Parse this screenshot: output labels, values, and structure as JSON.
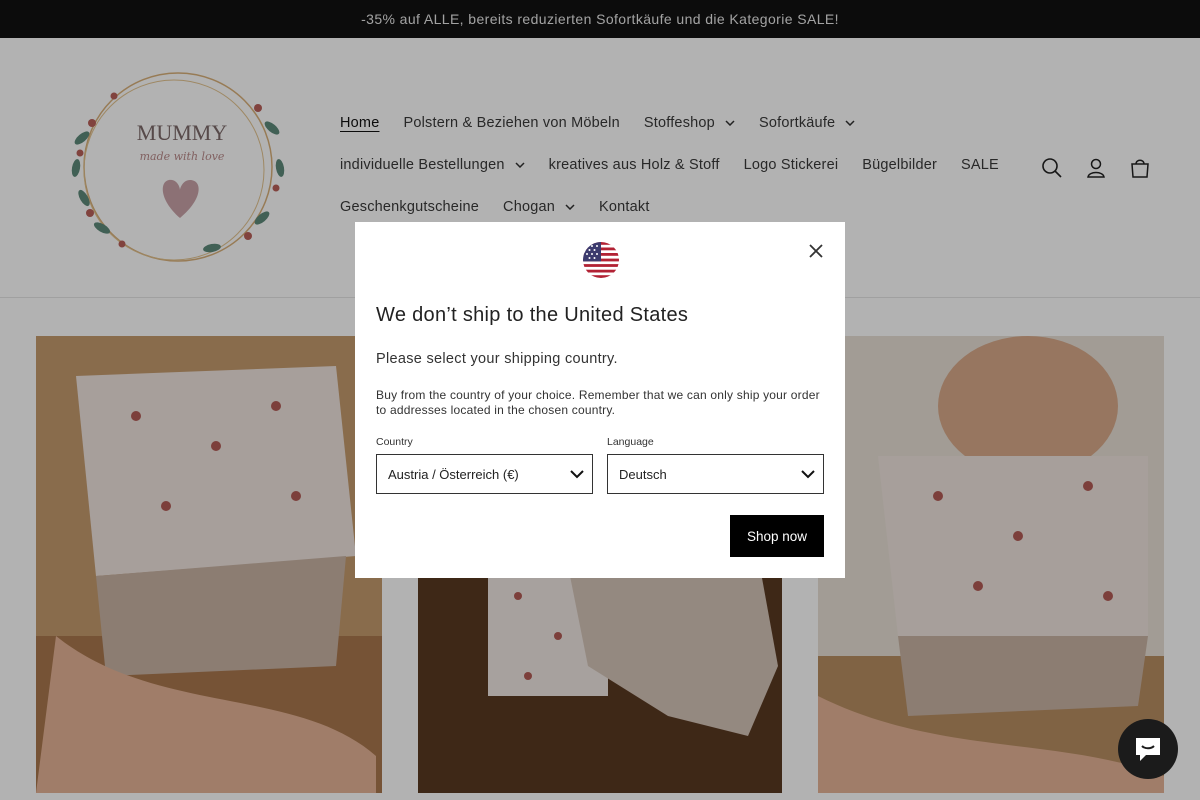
{
  "announcement": "-35% auf ALLE, bereits reduzierten Sofortkäufe und die Kategorie SALE!",
  "logo": {
    "text_top": "MUMMY",
    "text_script": "made with love",
    "icon": "floral-wreath-heart-logo"
  },
  "nav": {
    "rows": [
      [
        {
          "label": "Home",
          "active": true,
          "dropdown": false
        },
        {
          "label": "Polstern & Beziehen von Möbeln",
          "dropdown": false
        },
        {
          "label": "Stoffeshop",
          "dropdown": true
        },
        {
          "label": "Sofortkäufe",
          "dropdown": true
        }
      ],
      [
        {
          "label": "individuelle Bestellungen",
          "dropdown": true
        },
        {
          "label": "kreatives aus Holz & Stoff",
          "dropdown": false
        },
        {
          "label": "Logo Stickerei",
          "dropdown": false
        },
        {
          "label": "Bügelbilder",
          "dropdown": false
        },
        {
          "label": "SALE",
          "dropdown": false
        }
      ],
      [
        {
          "label": "Geschenkgutscheine",
          "dropdown": false
        },
        {
          "label": "Chogan",
          "dropdown": true
        },
        {
          "label": "Kontakt",
          "dropdown": false
        }
      ]
    ]
  },
  "header_icons": [
    "search-icon",
    "account-icon",
    "cart-icon"
  ],
  "modal": {
    "flag_icon": "us-flag-icon",
    "title": "We don’t ship to the United States",
    "subtitle": "Please select your shipping country.",
    "description": "Buy from the country of your choice. Remember that we can only ship your order to addresses located in the chosen country.",
    "country_label": "Country",
    "country_value": "Austria / Österreich (€)",
    "language_label": "Language",
    "language_value": "Deutsch",
    "button": "Shop now"
  },
  "colors": {
    "topbar": "#121212",
    "button": "#000000",
    "overlay": "rgba(0,0,0,0.30)",
    "chat": "#1b1b1b"
  }
}
